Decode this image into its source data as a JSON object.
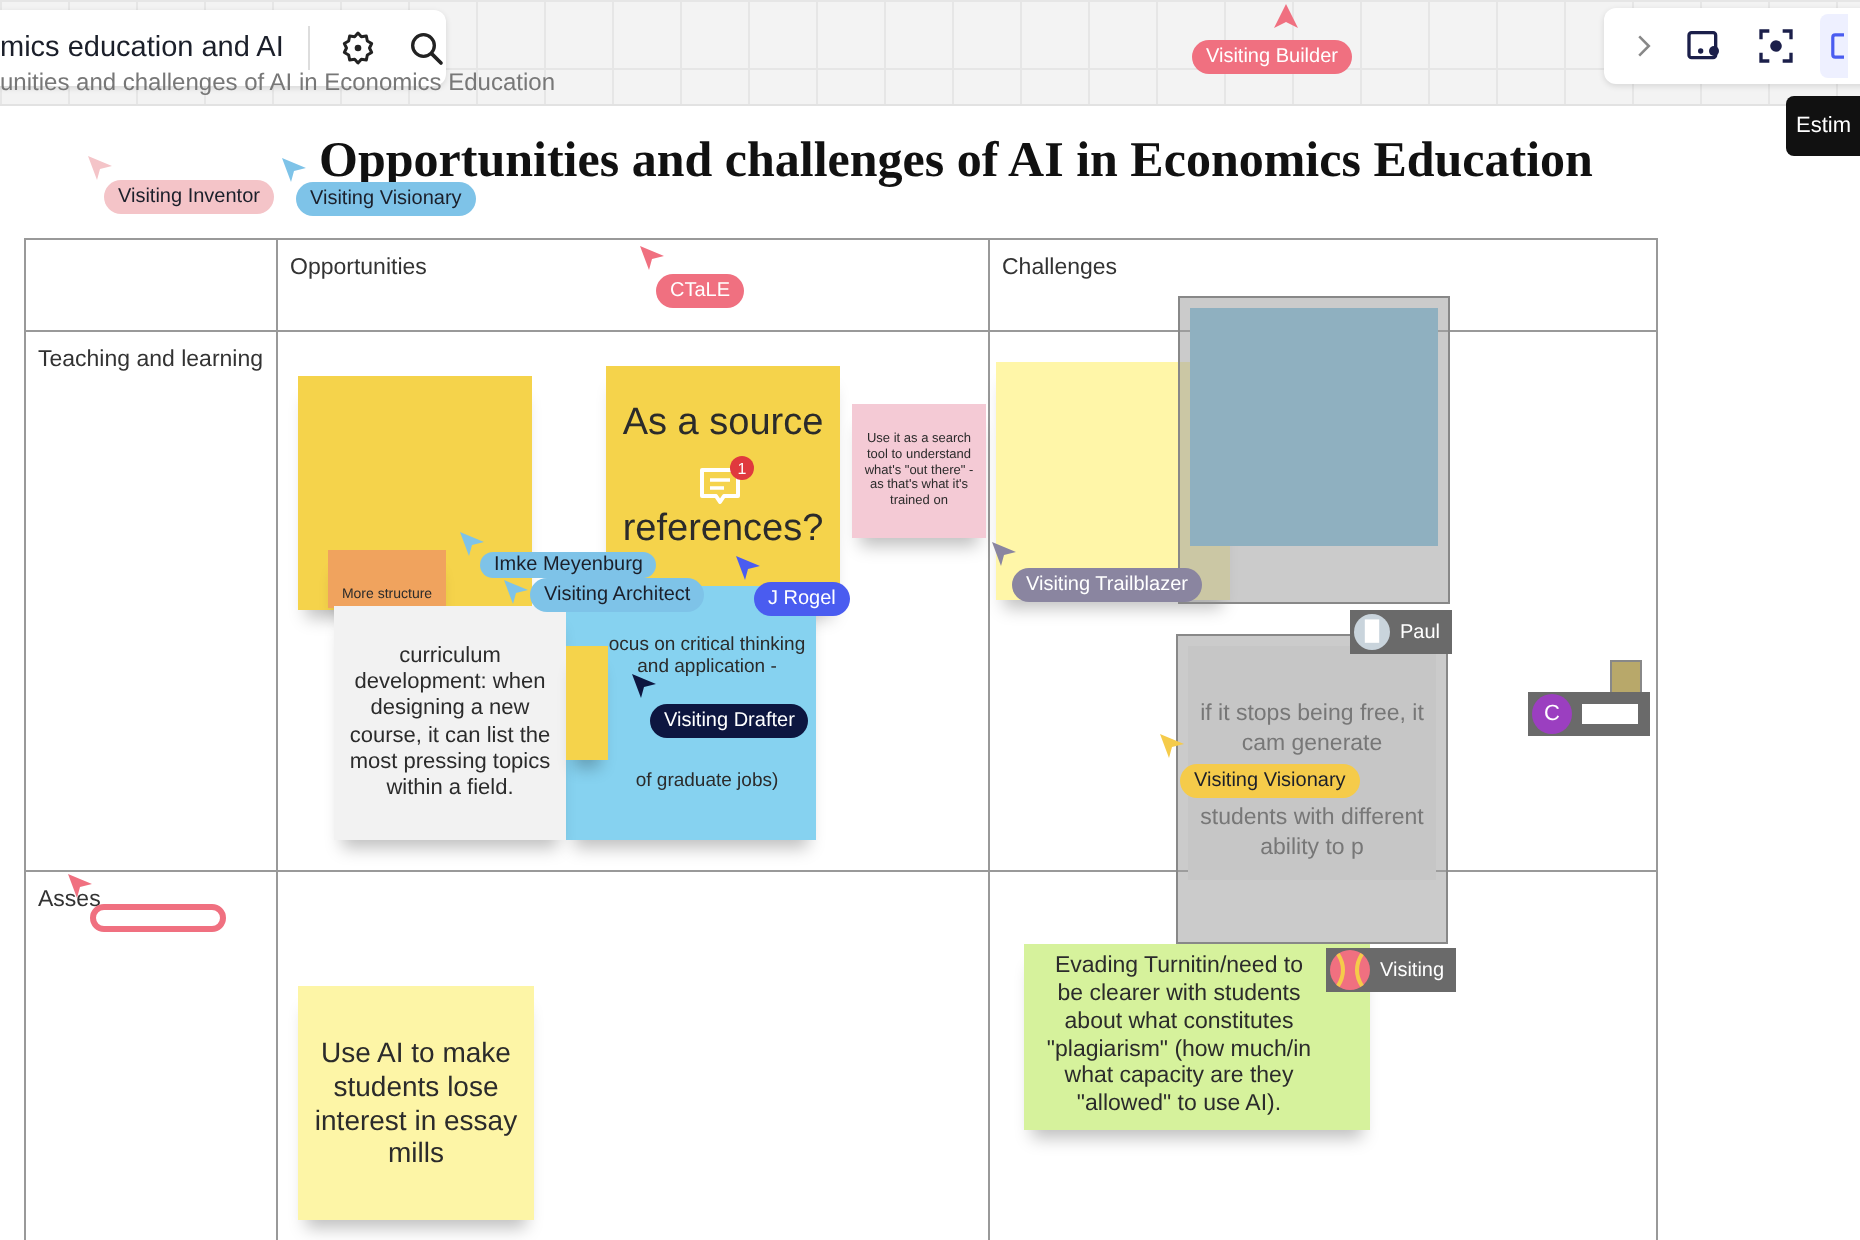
{
  "board": {
    "title": "mics education and AI",
    "frame_label": "unities and challenges of AI in Economics Education"
  },
  "toolbar": {
    "tooltip": "Estim"
  },
  "heading": "Opportunities and challenges of AI in Economics Education",
  "table": {
    "columns": [
      "Opportunities",
      "Challenges"
    ],
    "rows": [
      "Teaching and learning",
      "Asses"
    ]
  },
  "notes": [
    {
      "kind": "sticky",
      "color": "#f5d34b"
    },
    {
      "kind": "sticky",
      "color": "#f0a35e",
      "text": "More structure"
    },
    {
      "kind": "sticky",
      "color": "#f2f2f2",
      "text": "curriculum development: when designing a new course, it can list the most pressing topics within a field."
    },
    {
      "kind": "sticky",
      "color": "#f5d34b"
    },
    {
      "kind": "sticky",
      "color": "#f5d34b",
      "text": "As a source",
      "text_2": "references?",
      "comment_count": "1"
    },
    {
      "kind": "sticky",
      "color": "#86d2f0",
      "text": "ocus on critical thinking and application -",
      "text_2": "of graduate jobs)"
    },
    {
      "kind": "sticky",
      "color": "#f4cad5",
      "text": "Use it as a search tool to understand what's \"out there\" - as that's what it's trained on"
    },
    {
      "kind": "sticky",
      "color": "#fff6a8"
    },
    {
      "kind": "masked",
      "color": "#8fb0c0"
    },
    {
      "kind": "masked",
      "color": "#c6c6c6",
      "text": "if it stops being free, it cam generate",
      "text_2": "students with different ability to p"
    },
    {
      "kind": "sticky",
      "color": "#fdf5a6",
      "text": "Use AI to make students lose interest in essay mills"
    },
    {
      "kind": "sticky",
      "color": "#d6f29c",
      "text": "Evading Turnitin/need to be clearer with students about what constitutes \"plagiarism\" (how much/in what capacity are they \"allowed\" to use AI)."
    }
  ],
  "cursors": [
    {
      "name": "Visiting Builder",
      "color": "#f07080",
      "light_text": true
    },
    {
      "name": "Visiting Inventor",
      "color": "#f4c4c8",
      "light_text": false
    },
    {
      "name": "Visiting Visionary",
      "color": "#7ec3e8",
      "light_text": false
    },
    {
      "name": "CTaLE",
      "color": "#f07080",
      "light_text": true
    },
    {
      "name": "Imke Meyenburg",
      "color": "#7ec3e8",
      "light_text": false
    },
    {
      "name": "Visiting Architect",
      "color": "#7ec3e8",
      "light_text": false
    },
    {
      "name": "J Rogel",
      "color": "#4a5cf0",
      "light_text": true
    },
    {
      "name": "Visiting Drafter",
      "color": "#0d1640",
      "light_text": true
    },
    {
      "name": "Visiting Trailblazer",
      "color": "#8a85a0",
      "light_text": true
    },
    {
      "name": "Visiting Visionary",
      "color": "#f5cb4a",
      "light_text": false
    },
    {
      "color": "#f07080"
    }
  ],
  "editors": [
    {
      "name": "Paul",
      "kind": "photo"
    },
    {
      "name": "Visiting",
      "kind": "ball"
    },
    {
      "kind": "letter",
      "initial": "C"
    }
  ]
}
